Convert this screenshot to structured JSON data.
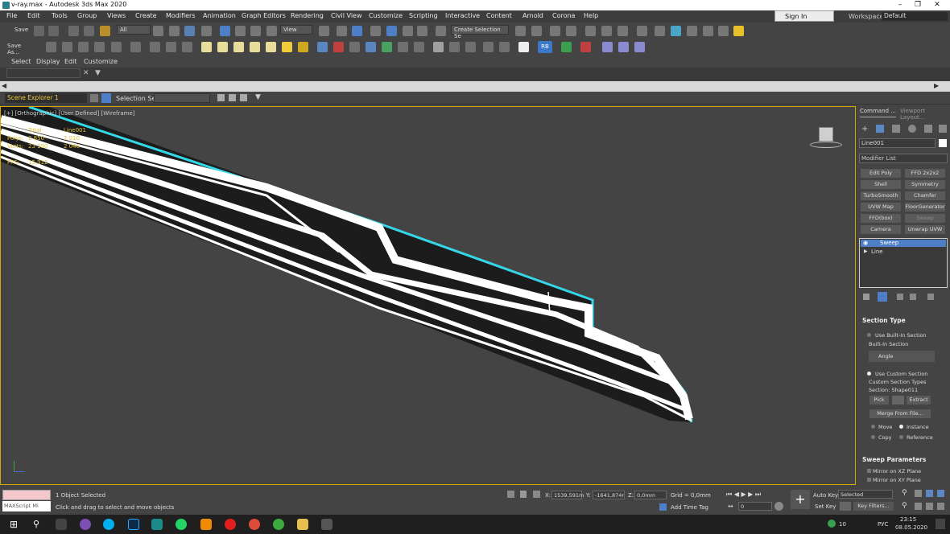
{
  "window": {
    "title": "v-ray.max - Autodesk 3ds Max 2020"
  },
  "menu": {
    "items": [
      "File",
      "Edit",
      "Tools",
      "Group",
      "Views",
      "Create",
      "Modifiers",
      "Animation",
      "Graph Editors",
      "Rendering",
      "Civil View",
      "Customize",
      "Scripting",
      "Interactive",
      "Content",
      "Arnold",
      "Corona",
      "Help"
    ],
    "signin": "Sign In",
    "workspaces_label": "Workspaces:",
    "workspaces_value": "Default"
  },
  "toolbar": {
    "save": "Save",
    "save_as": "Save As...",
    "filter": "All",
    "refcoord": "View",
    "create_selection_set": "Create Selection Se",
    "rb": "RB"
  },
  "subtoolbar": {
    "items": [
      "Select",
      "Display",
      "Edit",
      "Customize"
    ]
  },
  "scene_explorer": {
    "name": "Scene Explorer 1",
    "selection_set_label": "Selection Set:"
  },
  "viewport": {
    "label": "[+] [Orthographic] [User Defined] [Wireframe]",
    "stats": {
      "header_total": "Total",
      "header_obj": "Line001",
      "polys_label": "Polys:",
      "polys_total": "2 850",
      "polys_obj": "2 010",
      "verts_label": "Verts:",
      "verts_total": "23 190",
      "verts_obj": "2 046",
      "fps_label": "FPS:",
      "fps_value": "15,912"
    }
  },
  "command_panel": {
    "tab_command": "Command ...",
    "tab_viewport": "Viewport Layout...",
    "object_name": "Line001",
    "modifier_list": "Modifier List",
    "modifiers": [
      "Edit Poly",
      "FFD 2x2x2",
      "Shell",
      "Symmetry",
      "TurboSmooth",
      "Chamfer",
      "UVW Map",
      "FloorGenerator",
      "FFD(box)",
      "Sweep",
      "Camera Resolution M",
      "Unwrap UVW"
    ],
    "stack": [
      "Sweep",
      "Line"
    ],
    "section_type": {
      "title": "Section Type",
      "use_builtin": "Use Built-In Section",
      "builtin_label": "Built-In Section",
      "builtin_value": "Angle",
      "use_custom": "Use Custom Section",
      "custom_types": "Custom Section Types",
      "section_label": "Section: Shape011",
      "pick": "Pick",
      "extract": "Extract",
      "merge": "Merge From File...",
      "move": "Move",
      "instance": "Instance",
      "copy": "Copy",
      "reference": "Reference"
    },
    "sweep_params": {
      "title": "Sweep Parameters",
      "mirror_xz": "Mirror on XZ Plane",
      "mirror_xy": "Mirror on XY Plane"
    }
  },
  "status": {
    "maxscript": "MAXScript Mi",
    "objects_selected": "1 Object Selected",
    "hint": "Click and drag to select and move objects",
    "x_label": "X:",
    "x_value": "1539,591m",
    "y_label": "Y:",
    "y_value": "-1641,874r",
    "z_label": "Z:",
    "z_value": "0,0mm",
    "grid": "Grid = 0,0mm",
    "add_time_tag": "Add Time Tag",
    "autokey": "Auto Key",
    "setkey": "Set Key",
    "selected": "Selected",
    "key_filters": "Key Filters...",
    "frame": "0"
  },
  "taskbar": {
    "lang": "РУС",
    "time": "23:15",
    "date": "08.05.2020",
    "temp": "10"
  },
  "colors": {
    "viewport_border": "#d8a800",
    "selection": "#4e7fc6",
    "cyan": "#35d6e6"
  }
}
